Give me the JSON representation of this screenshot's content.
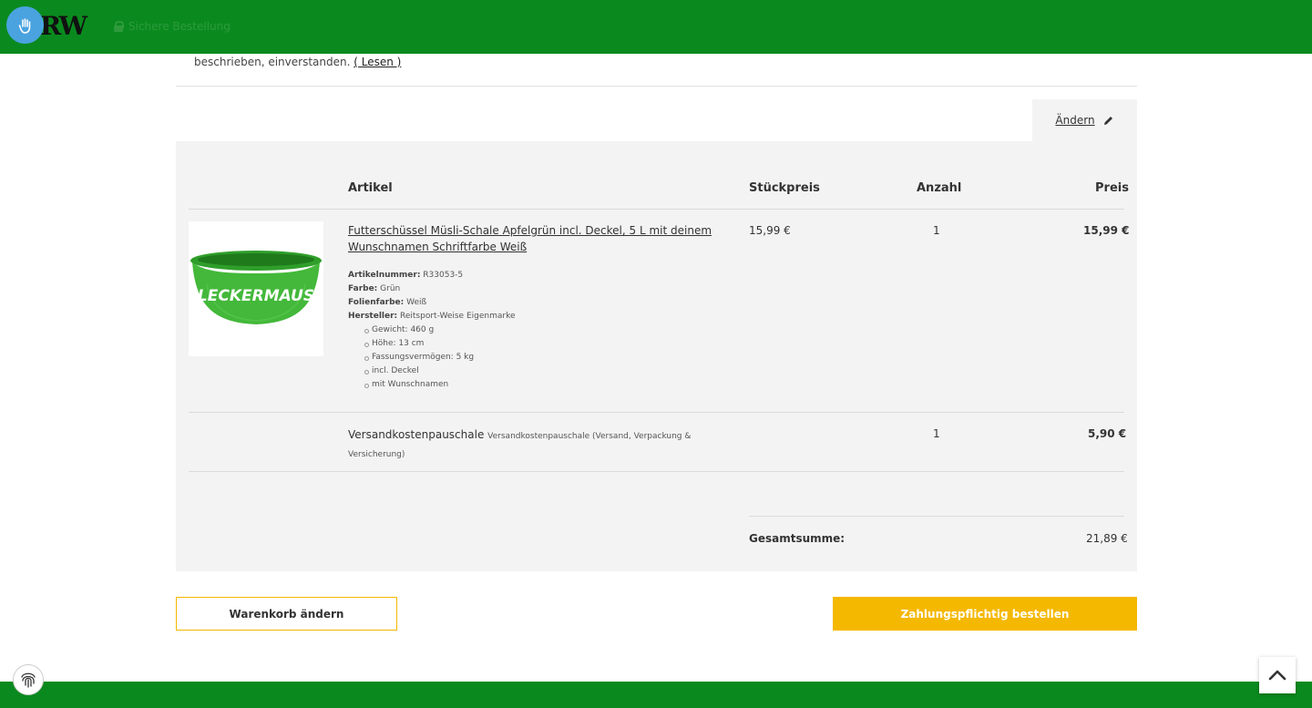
{
  "header": {
    "logo": "RW",
    "secure_text": "Sichere Bestellung",
    "brand_color": "#0a8a1e"
  },
  "terms": {
    "text": "beschrieben, einverstanden. ",
    "link": "( Lesen )"
  },
  "edit_link": "Ändern",
  "table": {
    "headers": {
      "article": "Artikel",
      "unit_price": "Stückpreis",
      "quantity": "Anzahl",
      "price": "Preis"
    },
    "product": {
      "image_label": "LECKERMAUS",
      "title": "Futterschüssel Müsli-Schale Apfelgrün incl. Deckel, 5 L mit deinem Wunschnamen Schriftfarbe Weiß",
      "attributes": [
        {
          "key": "Artikelnummer:",
          "value": " R33053-5"
        },
        {
          "key": "Farbe:",
          "value": " Grün"
        },
        {
          "key": "Folienfarbe:",
          "value": " Weiß"
        },
        {
          "key": "Hersteller:",
          "value": " Reitsport-Weise Eigenmarke"
        }
      ],
      "bullets": [
        "Gewicht: 460 g",
        "Höhe: 13 cm",
        "Fassungsvermögen: 5 kg",
        "incl. Deckel",
        "mit Wunschnamen"
      ],
      "unit_price": "15,99 €",
      "quantity": "1",
      "price": "15,99 €"
    },
    "shipping": {
      "name": "Versandkostenpauschale",
      "description": "Versandkostenpauschale (Versand, Verpackung & Versicherung)",
      "quantity": "1",
      "price": "5,90 €"
    },
    "total_label": "Gesamtsumme:",
    "total_value": "21,89 €"
  },
  "buttons": {
    "edit_cart": "Warenkorb ändern",
    "order": "Zahlungspflichtig bestellen",
    "accent": "#f5b800"
  },
  "icons": [
    "accessibility-icon",
    "lock-icon",
    "pencil-icon",
    "fingerprint-icon",
    "chevron-up-icon"
  ]
}
